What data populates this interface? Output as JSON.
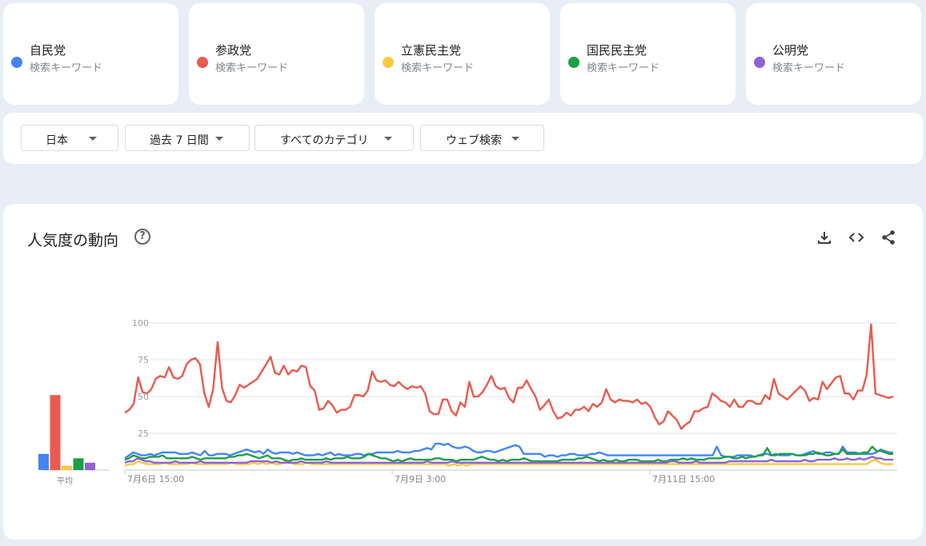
{
  "terms": [
    {
      "name": "自民党",
      "sub": "検索キーワード",
      "color": "#4285f4"
    },
    {
      "name": "参政党",
      "sub": "検索キーワード",
      "color": "#ea5a4e"
    },
    {
      "name": "立憲民主党",
      "sub": "検索キーワード",
      "color": "#fbc842"
    },
    {
      "name": "国民民主党",
      "sub": "検索キーワード",
      "color": "#1e9e47"
    },
    {
      "name": "公明党",
      "sub": "検索キーワード",
      "color": "#8e63d6"
    }
  ],
  "filters": {
    "region": "日本",
    "period": "過去 7 日間",
    "category": "すべてのカテゴリ",
    "search_type": "ウェブ検索"
  },
  "section": {
    "title": "人気度の動向",
    "help_icon": "help-circle-icon",
    "download_icon": "download-icon",
    "embed_icon": "code-icon",
    "share_icon": "share-icon"
  },
  "chart_data": {
    "type": "line",
    "ylim": [
      0,
      100
    ],
    "y_ticks": [
      "100",
      "75",
      "50",
      "25"
    ],
    "x_ticks": [
      "7月6日 15:00",
      "7月9日 3:00",
      "7月11日 15:00"
    ],
    "grid": true,
    "averages_label": "平均",
    "averages": [
      11,
      51,
      3,
      8,
      5
    ],
    "series": [
      {
        "name": "自民党",
        "color": "#4285f4",
        "values": [
          8,
          10,
          12,
          11,
          10,
          10,
          11,
          10,
          11,
          12,
          12,
          12,
          12,
          11,
          11,
          11,
          12,
          11,
          10,
          13,
          10,
          10,
          11,
          11,
          11,
          10,
          11,
          12,
          13,
          14,
          13,
          12,
          13,
          11,
          14,
          12,
          11,
          12,
          12,
          12,
          11,
          12,
          11,
          10,
          10,
          10,
          11,
          10,
          11,
          12,
          10,
          11,
          10,
          10,
          10,
          11,
          11,
          10,
          11,
          11,
          12,
          12,
          12,
          12,
          12,
          13,
          12,
          12,
          12,
          13,
          13,
          14,
          15,
          14,
          18,
          18,
          17,
          18,
          16,
          15,
          15,
          16,
          15,
          13,
          12,
          12,
          13,
          13,
          12,
          13,
          14,
          15,
          16,
          17,
          16,
          11,
          11,
          11,
          11,
          11,
          9,
          10,
          10,
          9,
          10,
          10,
          11,
          11,
          10,
          10,
          10,
          11,
          11,
          12,
          11,
          10,
          10,
          10,
          10,
          10,
          10,
          10,
          10,
          10,
          10,
          10,
          10,
          10,
          10,
          10,
          10,
          10,
          10,
          10,
          10,
          10,
          10,
          10,
          10,
          10,
          10,
          16,
          10,
          9,
          9,
          9,
          10,
          10,
          10,
          10,
          9,
          10,
          11,
          11,
          10,
          11,
          10,
          10,
          10,
          11,
          10,
          10,
          11,
          12,
          13,
          11,
          11,
          12,
          12,
          11,
          11,
          16,
          12,
          12,
          12,
          11,
          11,
          11,
          11,
          12,
          14,
          13,
          12,
          12
        ]
      },
      {
        "name": "参政党",
        "color": "#ea5a4e",
        "values": [
          39,
          41,
          45,
          63,
          53,
          52,
          55,
          62,
          64,
          63,
          70,
          63,
          62,
          64,
          72,
          75,
          76,
          72,
          52,
          43,
          55,
          87,
          56,
          47,
          46,
          51,
          58,
          56,
          58,
          60,
          62,
          67,
          72,
          77,
          66,
          65,
          71,
          65,
          68,
          67,
          71,
          70,
          57,
          54,
          41,
          42,
          47,
          44,
          39,
          41,
          41,
          43,
          51,
          51,
          50,
          54,
          67,
          61,
          60,
          61,
          58,
          57,
          60,
          57,
          55,
          57,
          56,
          57,
          52,
          40,
          38,
          38,
          48,
          48,
          40,
          37,
          46,
          43,
          60,
          50,
          50,
          53,
          58,
          64,
          57,
          55,
          56,
          49,
          46,
          56,
          56,
          61,
          55,
          50,
          41,
          44,
          48,
          40,
          35,
          36,
          39,
          37,
          41,
          41,
          43,
          40,
          45,
          43,
          46,
          55,
          48,
          46,
          48,
          47,
          47,
          46,
          48,
          45,
          46,
          43,
          36,
          31,
          33,
          40,
          37,
          34,
          28,
          31,
          33,
          40,
          40,
          42,
          43,
          52,
          50,
          47,
          46,
          43,
          48,
          43,
          43,
          47,
          47,
          45,
          45,
          51,
          48,
          62,
          52,
          50,
          48,
          51,
          54,
          57,
          54,
          47,
          49,
          48,
          60,
          55,
          59,
          63,
          64,
          52,
          52,
          48,
          54,
          54,
          65,
          99,
          52,
          51,
          50,
          49,
          50
        ]
      },
      {
        "name": "立憲民主党",
        "color": "#fbc842",
        "values": [
          3,
          4,
          4,
          6,
          5,
          4,
          4,
          4,
          4,
          5,
          4,
          4,
          4,
          4,
          4,
          5,
          4,
          4,
          4,
          4,
          4,
          4,
          4,
          4,
          5,
          4,
          4,
          4,
          4,
          5,
          4,
          5,
          4,
          5,
          4,
          4,
          6,
          6,
          4,
          4,
          4,
          5,
          4,
          4,
          4,
          4,
          4,
          4,
          4,
          4,
          4,
          4,
          4,
          4,
          4,
          4,
          4,
          4,
          4,
          4,
          4,
          4,
          4,
          4,
          4,
          4,
          4,
          4,
          4,
          4,
          4,
          4,
          4,
          3,
          4,
          3,
          4,
          3,
          4,
          4,
          4,
          4,
          4,
          4,
          4,
          4,
          4,
          4,
          4,
          4,
          4,
          4,
          4,
          4,
          4,
          4,
          4,
          4,
          4,
          4,
          4,
          4,
          4,
          4,
          4,
          4,
          4,
          4,
          4,
          4,
          4,
          4,
          4,
          4,
          4,
          4,
          4,
          4,
          4,
          4,
          4,
          4,
          4,
          4,
          4,
          4,
          4,
          4,
          4,
          4,
          4,
          4,
          4,
          4,
          4,
          4,
          4,
          4,
          4,
          4,
          4,
          4,
          4,
          4,
          4,
          4,
          4,
          4,
          4,
          4,
          4,
          4,
          4,
          4,
          4,
          4,
          4,
          4,
          4,
          4,
          4,
          4,
          4,
          4,
          4,
          4,
          4,
          4,
          6,
          7,
          5,
          4,
          4,
          4
        ]
      },
      {
        "name": "国民民主党",
        "color": "#1e9e47",
        "values": [
          7,
          8,
          10,
          9,
          8,
          8,
          9,
          9,
          9,
          10,
          8,
          8,
          8,
          8,
          8,
          8,
          9,
          8,
          7,
          8,
          8,
          8,
          8,
          8,
          8,
          9,
          9,
          10,
          10,
          11,
          10,
          9,
          8,
          9,
          10,
          8,
          8,
          8,
          7,
          6,
          7,
          7,
          8,
          7,
          7,
          7,
          7,
          7,
          8,
          7,
          8,
          8,
          8,
          9,
          8,
          8,
          8,
          9,
          11,
          10,
          9,
          8,
          8,
          7,
          6,
          7,
          6,
          7,
          8,
          7,
          7,
          7,
          7,
          7,
          8,
          8,
          7,
          7,
          7,
          6,
          7,
          7,
          7,
          7,
          8,
          9,
          8,
          7,
          7,
          6,
          7,
          6,
          7,
          7,
          7,
          8,
          7,
          6,
          6,
          6,
          6,
          6,
          6,
          6,
          7,
          7,
          7,
          7,
          8,
          8,
          9,
          8,
          7,
          6,
          7,
          6,
          6,
          7,
          6,
          6,
          7,
          7,
          7,
          6,
          6,
          6,
          6,
          7,
          6,
          6,
          7,
          7,
          7,
          8,
          7,
          8,
          7,
          7,
          7,
          8,
          8,
          8,
          8,
          9,
          9,
          8,
          8,
          9,
          8,
          9,
          9,
          10,
          10,
          15,
          10,
          10,
          11,
          11,
          11,
          11,
          10,
          10,
          10,
          11,
          11,
          12,
          11,
          10,
          10,
          11,
          11,
          14,
          11,
          11,
          11,
          11,
          12,
          12,
          16,
          13,
          13,
          12,
          11,
          11
        ]
      },
      {
        "name": "公明党",
        "color": "#8e63d6",
        "values": [
          5,
          6,
          6,
          8,
          7,
          6,
          6,
          5,
          5,
          5,
          5,
          5,
          6,
          5,
          5,
          5,
          5,
          5,
          6,
          5,
          5,
          5,
          5,
          5,
          5,
          5,
          5,
          5,
          5,
          5,
          6,
          6,
          6,
          6,
          6,
          5,
          6,
          5,
          5,
          5,
          5,
          5,
          6,
          5,
          5,
          5,
          5,
          5,
          6,
          5,
          5,
          5,
          5,
          5,
          5,
          5,
          5,
          5,
          5,
          5,
          5,
          5,
          5,
          5,
          5,
          5,
          5,
          5,
          5,
          5,
          5,
          5,
          6,
          5,
          5,
          5,
          5,
          5,
          6,
          5,
          5,
          5,
          5,
          5,
          5,
          5,
          5,
          5,
          5,
          5,
          5,
          5,
          5,
          5,
          5,
          5,
          5,
          5,
          5,
          5,
          5,
          5,
          5,
          5,
          5,
          5,
          5,
          5,
          5,
          5,
          5,
          5,
          5,
          5,
          5,
          5,
          5,
          5,
          5,
          5,
          5,
          5,
          5,
          5,
          5,
          5,
          5,
          5,
          5,
          5,
          6,
          6,
          5,
          5,
          5,
          5,
          6,
          5,
          5,
          5,
          5,
          5,
          5,
          5,
          6,
          6,
          6,
          6,
          6,
          6,
          6,
          6,
          6,
          6,
          7,
          6,
          6,
          6,
          6,
          6,
          6,
          6,
          7,
          6,
          6,
          7,
          7,
          7,
          7,
          8,
          7,
          7,
          8,
          7,
          7,
          8,
          7,
          8,
          9,
          8,
          8,
          7,
          7,
          7
        ]
      }
    ]
  }
}
